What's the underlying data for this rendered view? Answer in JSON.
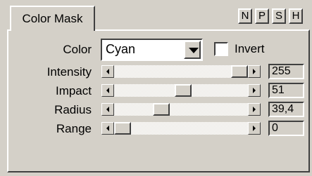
{
  "tab": {
    "label": "Color Mask"
  },
  "top_buttons": [
    "N",
    "P",
    "S",
    "H"
  ],
  "color": {
    "label": "Color",
    "selected": "Cyan",
    "invert_label": "Invert",
    "invert_checked": false
  },
  "sliders": [
    {
      "label": "Intensity",
      "value": "255",
      "fraction": 1.0
    },
    {
      "label": "Impact",
      "value": "51",
      "fraction": 0.52
    },
    {
      "label": "Radius",
      "value": "39,4",
      "fraction": 0.33
    },
    {
      "label": "Range",
      "value": "0",
      "fraction": 0.0
    }
  ]
}
